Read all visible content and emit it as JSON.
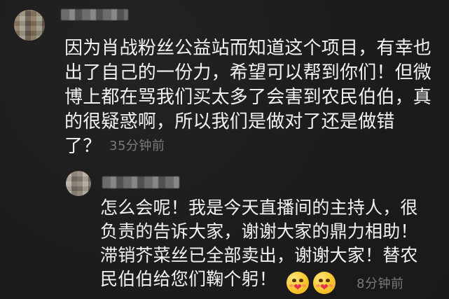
{
  "comment": {
    "text": "因为肖战粉丝公益站而知道这个项目，有幸也\n出了自己的一份力，希望可以帮到你们！但微\n博上都在骂我们买太多了会害到农民伯伯，真\n的很疑惑啊，所以我们是做对了还是做错\n了？",
    "time": "35分钟前"
  },
  "reply": {
    "text": "怎么会呢！我是今天直播间的主持人，很\n负责的告诉大家，谢谢大家的鼎力相助！\n滞销芥菜丝已全部卖出，谢谢大家！替农\n民伯伯给您们鞠个躬！",
    "time": "8分钟前",
    "emoji_icons": [
      "blush-heart-emoji-icon",
      "blush-heart-emoji-icon"
    ]
  },
  "colors": {
    "background": "#1d1d1d",
    "text": "#f2f2f2",
    "meta": "#7a7a7a",
    "emoji": "#f9cc34",
    "heart": "#e5354d"
  }
}
